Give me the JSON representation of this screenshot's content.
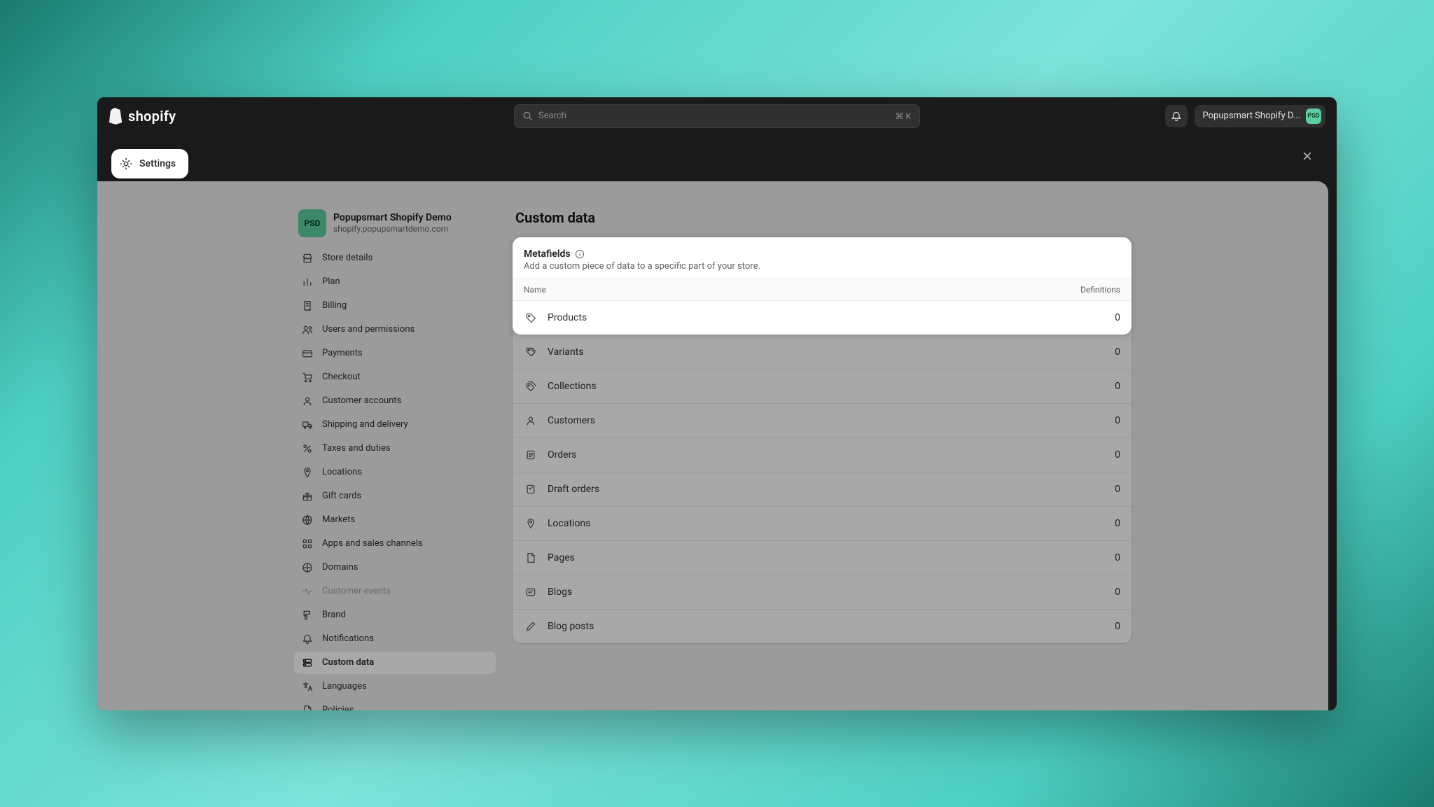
{
  "topbar": {
    "search_placeholder": "Search",
    "search_shortcut": "⌘ K",
    "store_name": "Popupsmart Shopify D...",
    "store_avatar": "PSD"
  },
  "settings_chip": "Settings",
  "store": {
    "avatar": "PSD",
    "name": "Popupsmart Shopify Demo",
    "domain": "shopify.popupsmartdemo.com"
  },
  "sidebar": {
    "items": [
      {
        "id": "store-details",
        "label": "Store details",
        "icon": "store"
      },
      {
        "id": "plan",
        "label": "Plan",
        "icon": "chart"
      },
      {
        "id": "billing",
        "label": "Billing",
        "icon": "receipt"
      },
      {
        "id": "users",
        "label": "Users and permissions",
        "icon": "users"
      },
      {
        "id": "payments",
        "label": "Payments",
        "icon": "card"
      },
      {
        "id": "checkout",
        "label": "Checkout",
        "icon": "cart"
      },
      {
        "id": "customer-accounts",
        "label": "Customer accounts",
        "icon": "person"
      },
      {
        "id": "shipping",
        "label": "Shipping and delivery",
        "icon": "truck"
      },
      {
        "id": "taxes",
        "label": "Taxes and duties",
        "icon": "percent"
      },
      {
        "id": "locations",
        "label": "Locations",
        "icon": "pin"
      },
      {
        "id": "gift-cards",
        "label": "Gift cards",
        "icon": "gift"
      },
      {
        "id": "markets",
        "label": "Markets",
        "icon": "globe"
      },
      {
        "id": "apps",
        "label": "Apps and sales channels",
        "icon": "grid"
      },
      {
        "id": "domains",
        "label": "Domains",
        "icon": "domain"
      },
      {
        "id": "customer-events",
        "label": "Customer events",
        "icon": "pulse",
        "disabled": true
      },
      {
        "id": "brand",
        "label": "Brand",
        "icon": "paint"
      },
      {
        "id": "notifications",
        "label": "Notifications",
        "icon": "bell"
      },
      {
        "id": "custom-data",
        "label": "Custom data",
        "icon": "db",
        "active": true
      },
      {
        "id": "languages",
        "label": "Languages",
        "icon": "lang"
      },
      {
        "id": "policies",
        "label": "Policies",
        "icon": "doc"
      }
    ]
  },
  "main": {
    "title": "Custom data",
    "metafields": {
      "heading": "Metafields",
      "description": "Add a custom piece of data to a specific part of your store.",
      "columns": {
        "name": "Name",
        "definitions": "Definitions"
      },
      "rows": [
        {
          "id": "products",
          "label": "Products",
          "icon": "tag",
          "count": 0
        },
        {
          "id": "variants",
          "label": "Variants",
          "icon": "tag3",
          "count": 0
        },
        {
          "id": "collections",
          "label": "Collections",
          "icon": "tags",
          "count": 0
        },
        {
          "id": "customers",
          "label": "Customers",
          "icon": "person",
          "count": 0
        },
        {
          "id": "orders",
          "label": "Orders",
          "icon": "order",
          "count": 0
        },
        {
          "id": "draft-orders",
          "label": "Draft orders",
          "icon": "draft",
          "count": 0
        },
        {
          "id": "locations",
          "label": "Locations",
          "icon": "pin",
          "count": 0
        },
        {
          "id": "pages",
          "label": "Pages",
          "icon": "page",
          "count": 0
        },
        {
          "id": "blogs",
          "label": "Blogs",
          "icon": "blog",
          "count": 0
        },
        {
          "id": "blog-posts",
          "label": "Blog posts",
          "icon": "pen",
          "count": 0
        }
      ]
    }
  }
}
